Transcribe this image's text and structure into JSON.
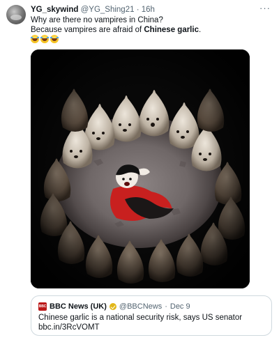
{
  "tweet": {
    "display_name": "YG_skywind",
    "handle": "@YG_Shing21",
    "separator": "·",
    "time": "16h",
    "more_label": "···",
    "line1": "Why are there no vampires in China?",
    "line2_prefix": "Because vampires are afraid of ",
    "line2_bold": "Chinese garlic",
    "line2_suffix": ".",
    "emoji": [
      "😂",
      "😂",
      "😂"
    ]
  },
  "media": {
    "description_icon": "cartoon-vampire-surrounded-by-garlic-image"
  },
  "quote": {
    "logo_text": "BBC",
    "name": "BBC News (UK)",
    "handle": "@BBCNews",
    "separator": "·",
    "date": "Dec 9",
    "text": "Chinese garlic is a national security risk, says US senator",
    "link": "bbc.in/3RcVOMT"
  },
  "colors": {
    "text": "#0f1419",
    "secondary": "#536471",
    "border": "#cfd9de",
    "verified_gold": "#e2b719",
    "bbc_red": "#bb1919"
  }
}
